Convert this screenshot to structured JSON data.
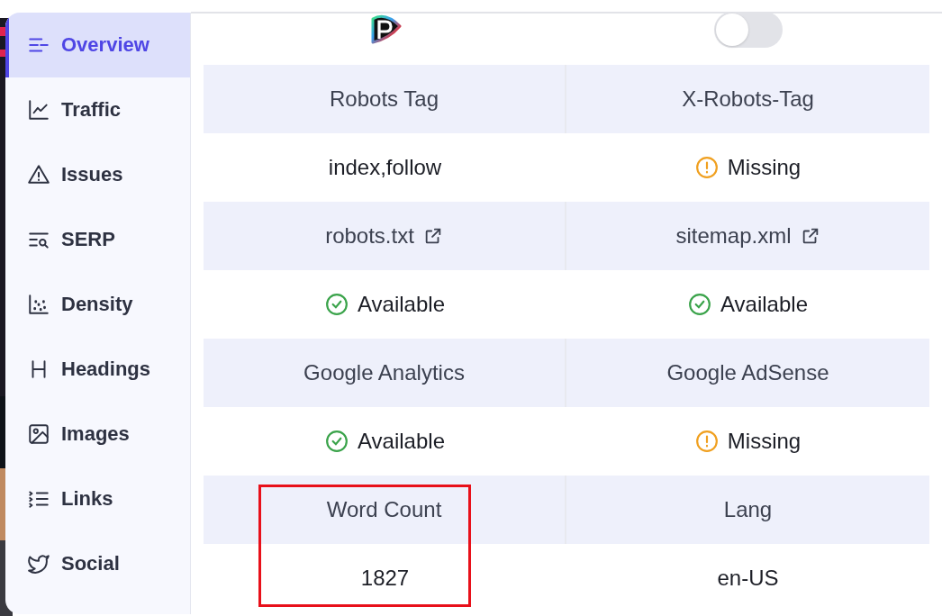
{
  "sidebar": {
    "items": [
      {
        "label": "Overview",
        "kind": "overview",
        "selected": true
      },
      {
        "label": "Traffic",
        "kind": "traffic",
        "selected": false
      },
      {
        "label": "Issues",
        "kind": "issues",
        "selected": false
      },
      {
        "label": "SERP",
        "kind": "serp",
        "selected": false
      },
      {
        "label": "Density",
        "kind": "density",
        "selected": false
      },
      {
        "label": "Headings",
        "kind": "headings",
        "selected": false
      },
      {
        "label": "Images",
        "kind": "images",
        "selected": false
      },
      {
        "label": "Links",
        "kind": "links",
        "selected": false
      },
      {
        "label": "Social",
        "kind": "social",
        "selected": false
      }
    ]
  },
  "top": {
    "toggle": {
      "on": false
    }
  },
  "grid": [
    {
      "kind": "header",
      "cells": [
        {
          "text": "Robots Tag"
        },
        {
          "text": "X-Robots-Tag"
        }
      ]
    },
    {
      "kind": "value",
      "cells": [
        {
          "text": "index,follow"
        },
        {
          "text": "Missing",
          "kind": "missing"
        }
      ]
    },
    {
      "kind": "header",
      "cells": [
        {
          "text": "robots.txt",
          "link": true
        },
        {
          "text": "sitemap.xml",
          "link": true
        }
      ]
    },
    {
      "kind": "value",
      "cells": [
        {
          "text": "Available",
          "kind": "available"
        },
        {
          "text": "Available",
          "kind": "available"
        }
      ]
    },
    {
      "kind": "header",
      "cells": [
        {
          "text": "Google Analytics"
        },
        {
          "text": "Google AdSense"
        }
      ]
    },
    {
      "kind": "value",
      "cells": [
        {
          "text": "Available",
          "kind": "available"
        },
        {
          "text": "Missing",
          "kind": "missing"
        }
      ]
    },
    {
      "kind": "header",
      "cells": [
        {
          "text": "Word Count",
          "framed": true
        },
        {
          "text": "Lang"
        }
      ]
    },
    {
      "kind": "value",
      "cells": [
        {
          "text": "1827",
          "framed": true
        },
        {
          "text": "en-US"
        }
      ]
    }
  ]
}
